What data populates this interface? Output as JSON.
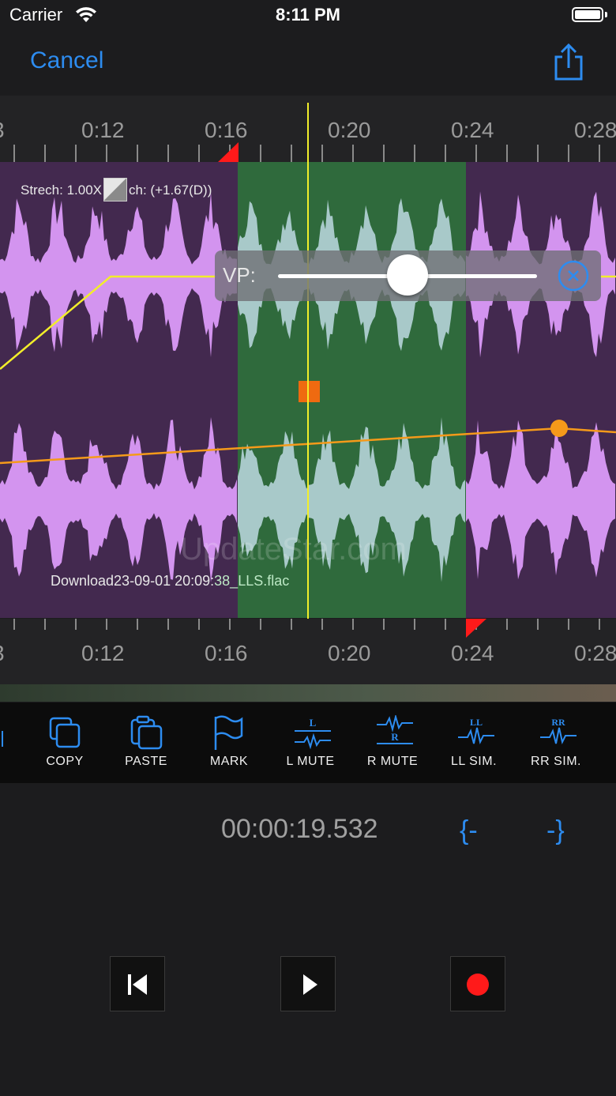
{
  "status_bar": {
    "carrier": "Carrier",
    "time": "8:11 PM"
  },
  "nav": {
    "cancel_label": "Cancel",
    "share_icon": "share-icon"
  },
  "ruler_top": {
    "labels": [
      "3",
      "0:12",
      "0:16",
      "0:20",
      "0:24",
      "0:28"
    ]
  },
  "ruler_bottom": {
    "labels": [
      "3",
      "0:12",
      "0:16",
      "0:20",
      "0:24",
      "0:28"
    ]
  },
  "waveform": {
    "stretch_label": "Strech: 1.00X",
    "pitch_label": "ch: (+1.67(D))",
    "filename_part1": "Download23-09-01 20:09:",
    "filename_part2": "38_LLS.flac",
    "watermark": "UpdateStar.com"
  },
  "vp_slider": {
    "label": "VP:",
    "value": 0.5
  },
  "toolbar": {
    "items": [
      {
        "label": "COPY",
        "icon": "copy-icon"
      },
      {
        "label": "PASTE",
        "icon": "paste-icon"
      },
      {
        "label": "MARK",
        "icon": "flag-icon"
      },
      {
        "label": "L MUTE",
        "icon": "l-mute-icon"
      },
      {
        "label": "R MUTE",
        "icon": "r-mute-icon"
      },
      {
        "label": "LL SIM.",
        "icon": "ll-sim-icon"
      },
      {
        "label": "RR SIM.",
        "icon": "rr-sim-icon"
      }
    ]
  },
  "time": {
    "readout": "00:00:19.532",
    "brace_left": "{-",
    "brace_right": "-}"
  },
  "transport": {
    "rewind_icon": "skip-to-start-icon",
    "play_icon": "play-icon",
    "record_icon": "record-icon"
  },
  "colors": {
    "accent": "#2d8cf0",
    "waveform_bg": "#43294f",
    "waveform_fill": "#d394ef",
    "selection": "#2f6a3c",
    "playhead": "#f2ee2a",
    "orange": "#f59a1a",
    "record": "#ff1a1a"
  }
}
